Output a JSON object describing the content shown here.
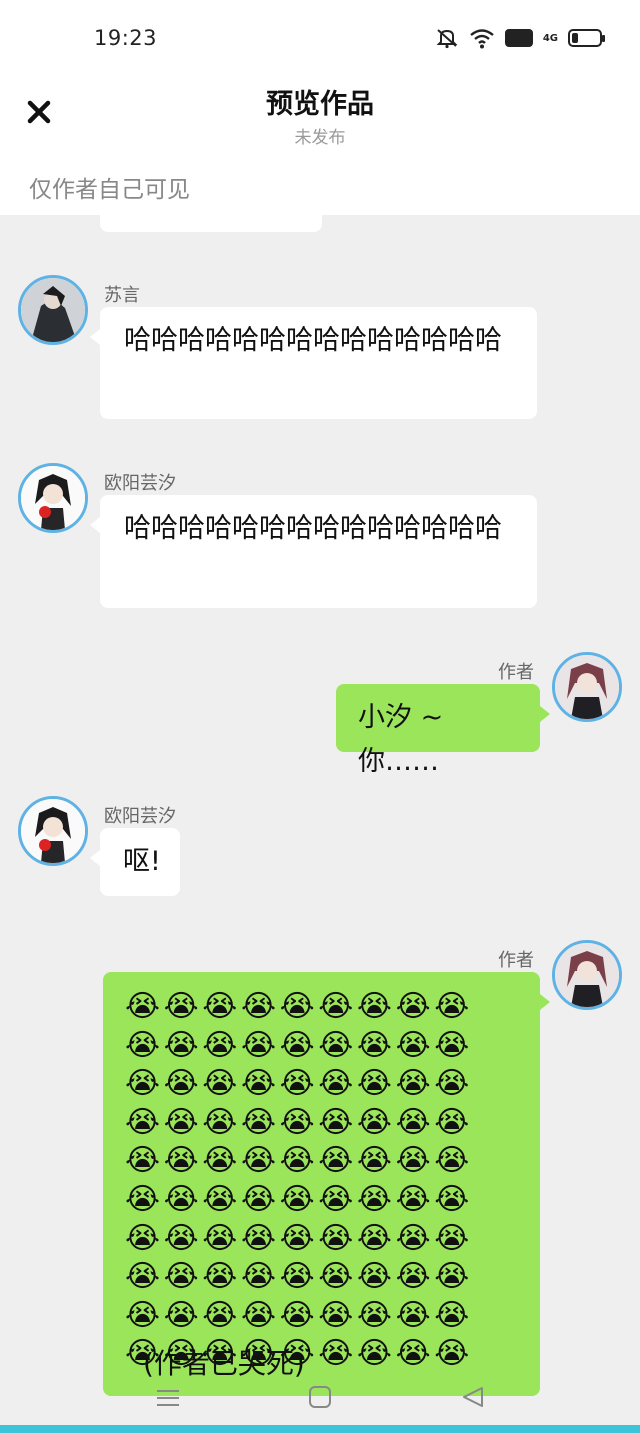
{
  "status": {
    "time": "19:23",
    "hd": "HD",
    "network": "4G"
  },
  "header": {
    "title": "预览作品",
    "subtitle": "未发布",
    "visibility": "仅作者自己可见"
  },
  "messages": [
    {
      "name": "苏言",
      "text": "哈哈哈哈哈哈哈哈哈哈哈哈哈哈"
    },
    {
      "name": "欧阳芸汐",
      "text": "哈哈哈哈哈哈哈哈哈哈哈哈哈哈"
    },
    {
      "name": "作者",
      "text": "小汐 ~ 你……"
    },
    {
      "name": "欧阳芸汐",
      "text": "呕!"
    },
    {
      "name": "作者",
      "emoji": "😭😭😭😭😭😭😭😭😭😭😭😭😭😭😭😭😭😭😭😭😭😭😭😭😭😭😭😭😭😭😭😭😭😭😭😭😭😭😭😭😭😭😭😭😭😭😭😭😭😭😭😭😭😭😭😭😭😭😭😭😭😭😭😭😭😭😭😭😭😭😭😭😭😭😭😭😭😭😭😭😭😭😭😭😭😭😭😭😭😭",
      "caption": "(作者已哭死)"
    }
  ],
  "colors": {
    "author_bubble": "#9be55a",
    "avatar_ring": "#5fb2e4",
    "chat_bg": "#efefef"
  },
  "icons": {
    "close": "close-icon",
    "nav_menu": "menu-icon",
    "nav_home": "home-icon",
    "nav_back": "back-icon"
  }
}
